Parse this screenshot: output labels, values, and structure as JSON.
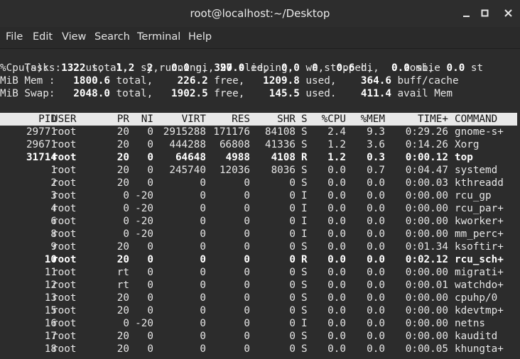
{
  "window": {
    "title": "root@localhost:~/Desktop",
    "controls": [
      "minimize",
      "maximize",
      "close"
    ]
  },
  "menu": [
    "File",
    "Edit",
    "View",
    "Search",
    "Terminal",
    "Help"
  ],
  "summary": {
    "tasks": {
      "label": "Tasks:",
      "total": "322",
      "total_label": "total,",
      "running": "2",
      "running_label": "running,",
      "sleeping": "320",
      "sleeping_label": "sleeping,",
      "stopped": "0",
      "stopped_label": "stopped,",
      "zombie": "0",
      "zombie_label": "zombie"
    },
    "cpu": {
      "label": "%Cpu(s):",
      "us": "1.2",
      "sy": "1.2",
      "ni": "0.0",
      "id": "97.0",
      "wa": "0.0",
      "hi": "0.6",
      "si": "0.0",
      "st": "0.0"
    },
    "mem": {
      "label": "MiB Mem :",
      "total": "1800.6",
      "free": "226.2",
      "used": "1209.8",
      "buff_cache": "364.6"
    },
    "swap": {
      "label": "MiB Swap:",
      "total": "2048.0",
      "free": "1902.5",
      "used": "145.5",
      "avail": "411.4"
    }
  },
  "columns": [
    "PID",
    "USER",
    "PR",
    "NI",
    "VIRT",
    "RES",
    "SHR",
    "S",
    "%CPU",
    "%MEM",
    "TIME+",
    "COMMAND"
  ],
  "processes": [
    {
      "pid": "29771",
      "user": "root",
      "pr": "20",
      "ni": "0",
      "virt": "2915288",
      "res": "171176",
      "shr": "84108",
      "s": "S",
      "cpu": "2.4",
      "mem": "9.3",
      "time": "0:29.26",
      "cmd": "gnome-s+",
      "bold": false
    },
    {
      "pid": "29671",
      "user": "root",
      "pr": "20",
      "ni": "0",
      "virt": "444288",
      "res": "66808",
      "shr": "41336",
      "s": "S",
      "cpu": "1.2",
      "mem": "3.6",
      "time": "0:14.26",
      "cmd": "Xorg",
      "bold": false
    },
    {
      "pid": "31714",
      "user": "root",
      "pr": "20",
      "ni": "0",
      "virt": "64648",
      "res": "4988",
      "shr": "4108",
      "s": "R",
      "cpu": "1.2",
      "mem": "0.3",
      "time": "0:00.12",
      "cmd": "top",
      "bold": true
    },
    {
      "pid": "1",
      "user": "root",
      "pr": "20",
      "ni": "0",
      "virt": "245740",
      "res": "12036",
      "shr": "8036",
      "s": "S",
      "cpu": "0.0",
      "mem": "0.7",
      "time": "0:04.47",
      "cmd": "systemd",
      "bold": false
    },
    {
      "pid": "2",
      "user": "root",
      "pr": "20",
      "ni": "0",
      "virt": "0",
      "res": "0",
      "shr": "0",
      "s": "S",
      "cpu": "0.0",
      "mem": "0.0",
      "time": "0:00.03",
      "cmd": "kthreadd",
      "bold": false
    },
    {
      "pid": "3",
      "user": "root",
      "pr": "0",
      "ni": "-20",
      "virt": "0",
      "res": "0",
      "shr": "0",
      "s": "I",
      "cpu": "0.0",
      "mem": "0.0",
      "time": "0:00.00",
      "cmd": "rcu_gp",
      "bold": false
    },
    {
      "pid": "4",
      "user": "root",
      "pr": "0",
      "ni": "-20",
      "virt": "0",
      "res": "0",
      "shr": "0",
      "s": "I",
      "cpu": "0.0",
      "mem": "0.0",
      "time": "0:00.00",
      "cmd": "rcu_par+",
      "bold": false
    },
    {
      "pid": "6",
      "user": "root",
      "pr": "0",
      "ni": "-20",
      "virt": "0",
      "res": "0",
      "shr": "0",
      "s": "I",
      "cpu": "0.0",
      "mem": "0.0",
      "time": "0:00.00",
      "cmd": "kworker+",
      "bold": false
    },
    {
      "pid": "8",
      "user": "root",
      "pr": "0",
      "ni": "-20",
      "virt": "0",
      "res": "0",
      "shr": "0",
      "s": "I",
      "cpu": "0.0",
      "mem": "0.0",
      "time": "0:00.00",
      "cmd": "mm_perc+",
      "bold": false
    },
    {
      "pid": "9",
      "user": "root",
      "pr": "20",
      "ni": "0",
      "virt": "0",
      "res": "0",
      "shr": "0",
      "s": "S",
      "cpu": "0.0",
      "mem": "0.0",
      "time": "0:01.34",
      "cmd": "ksoftir+",
      "bold": false
    },
    {
      "pid": "10",
      "user": "root",
      "pr": "20",
      "ni": "0",
      "virt": "0",
      "res": "0",
      "shr": "0",
      "s": "R",
      "cpu": "0.0",
      "mem": "0.0",
      "time": "0:02.12",
      "cmd": "rcu_sch+",
      "bold": true
    },
    {
      "pid": "11",
      "user": "root",
      "pr": "rt",
      "ni": "0",
      "virt": "0",
      "res": "0",
      "shr": "0",
      "s": "S",
      "cpu": "0.0",
      "mem": "0.0",
      "time": "0:00.00",
      "cmd": "migrati+",
      "bold": false
    },
    {
      "pid": "12",
      "user": "root",
      "pr": "rt",
      "ni": "0",
      "virt": "0",
      "res": "0",
      "shr": "0",
      "s": "S",
      "cpu": "0.0",
      "mem": "0.0",
      "time": "0:00.01",
      "cmd": "watchdo+",
      "bold": false
    },
    {
      "pid": "13",
      "user": "root",
      "pr": "20",
      "ni": "0",
      "virt": "0",
      "res": "0",
      "shr": "0",
      "s": "S",
      "cpu": "0.0",
      "mem": "0.0",
      "time": "0:00.00",
      "cmd": "cpuhp/0",
      "bold": false
    },
    {
      "pid": "15",
      "user": "root",
      "pr": "20",
      "ni": "0",
      "virt": "0",
      "res": "0",
      "shr": "0",
      "s": "S",
      "cpu": "0.0",
      "mem": "0.0",
      "time": "0:00.00",
      "cmd": "kdevtmp+",
      "bold": false
    },
    {
      "pid": "16",
      "user": "root",
      "pr": "0",
      "ni": "-20",
      "virt": "0",
      "res": "0",
      "shr": "0",
      "s": "I",
      "cpu": "0.0",
      "mem": "0.0",
      "time": "0:00.00",
      "cmd": "netns",
      "bold": false
    },
    {
      "pid": "17",
      "user": "root",
      "pr": "20",
      "ni": "0",
      "virt": "0",
      "res": "0",
      "shr": "0",
      "s": "S",
      "cpu": "0.0",
      "mem": "0.0",
      "time": "0:00.00",
      "cmd": "kauditd",
      "bold": false
    },
    {
      "pid": "18",
      "user": "root",
      "pr": "20",
      "ni": "0",
      "virt": "0",
      "res": "0",
      "shr": "0",
      "s": "S",
      "cpu": "0.0",
      "mem": "0.0",
      "time": "0:00.05",
      "cmd": "khungta+",
      "bold": false
    }
  ],
  "colors": {
    "titlebar": "#2d2d2d",
    "terminal_bg": "#2c2c2c",
    "text": "#e6e6e6",
    "header_bg": "#e8e8e8"
  }
}
